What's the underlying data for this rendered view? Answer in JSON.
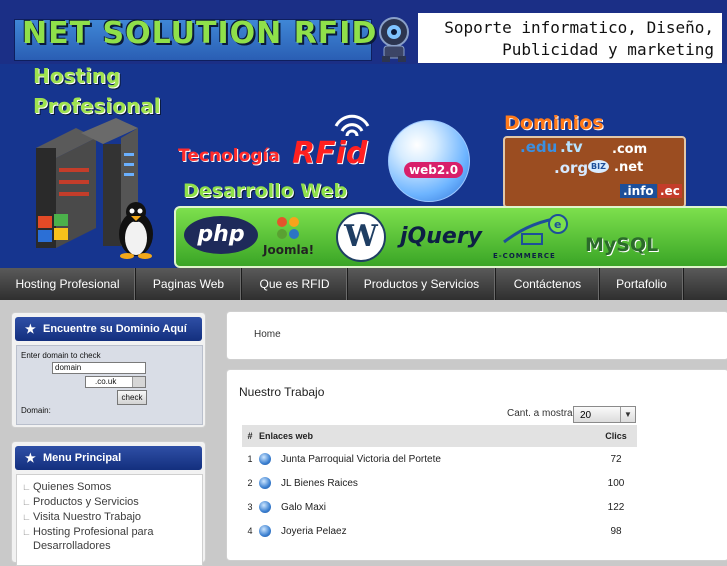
{
  "banner": {
    "logo_text": "NET SOLUTION RFID",
    "tagline_line1": "Soporte informatico, Diseño,",
    "tagline_line2": "Publicidad y marketing",
    "hosting_line1": "Hosting",
    "hosting_line2": "Profesional",
    "tech_label": "Tecnología",
    "rfid_label": "RFid",
    "dev_label": "Desarrollo Web",
    "web20_label": "web2.0",
    "domains_label": "Dominios",
    "tlds": [
      ".edu",
      ".tv",
      ".com",
      ".org",
      "BIZ",
      ".net",
      ".info",
      ".ec"
    ],
    "tech_logos": {
      "php": "php",
      "joomla": "Joomla!",
      "wordpress": "W",
      "jquery": "jQuery",
      "ecommerce": "E-COMMERCE",
      "mysql": "MySQL"
    }
  },
  "nav": {
    "items": [
      "Hosting Profesional",
      "Paginas Web",
      "Que es RFID",
      "Productos y Servicios",
      "Contáctenos",
      "Portafolio"
    ]
  },
  "domain_panel": {
    "title": "Encuentre su Dominio Aquí",
    "label": "Enter domain to check",
    "input_value": "domain",
    "ext_value": ".co.uk",
    "check_label": "check",
    "result_label": "Domain:"
  },
  "menu_panel": {
    "title": "Menu Principal",
    "items": [
      "Quienes Somos",
      "Productos y Servicios",
      "Visita Nuestro Trabajo",
      "Hosting Profesional para",
      "Desarrolladores"
    ]
  },
  "breadcrumb": {
    "home": "Home"
  },
  "work": {
    "title": "Nuestro Trabajo",
    "show_label": "Cant. a mostrar",
    "show_value": "20",
    "col_links": "Enlaces web",
    "col_clics": "Clics",
    "rows": [
      {
        "num": "1",
        "name": "Junta Parroquial Victoria del Portete",
        "clics": "72"
      },
      {
        "num": "2",
        "name": "JL Bienes Raices",
        "clics": "100"
      },
      {
        "num": "3",
        "name": "Galo Maxi",
        "clics": "122"
      },
      {
        "num": "4",
        "name": "Joyeria Pelaez",
        "clics": "98"
      }
    ]
  }
}
